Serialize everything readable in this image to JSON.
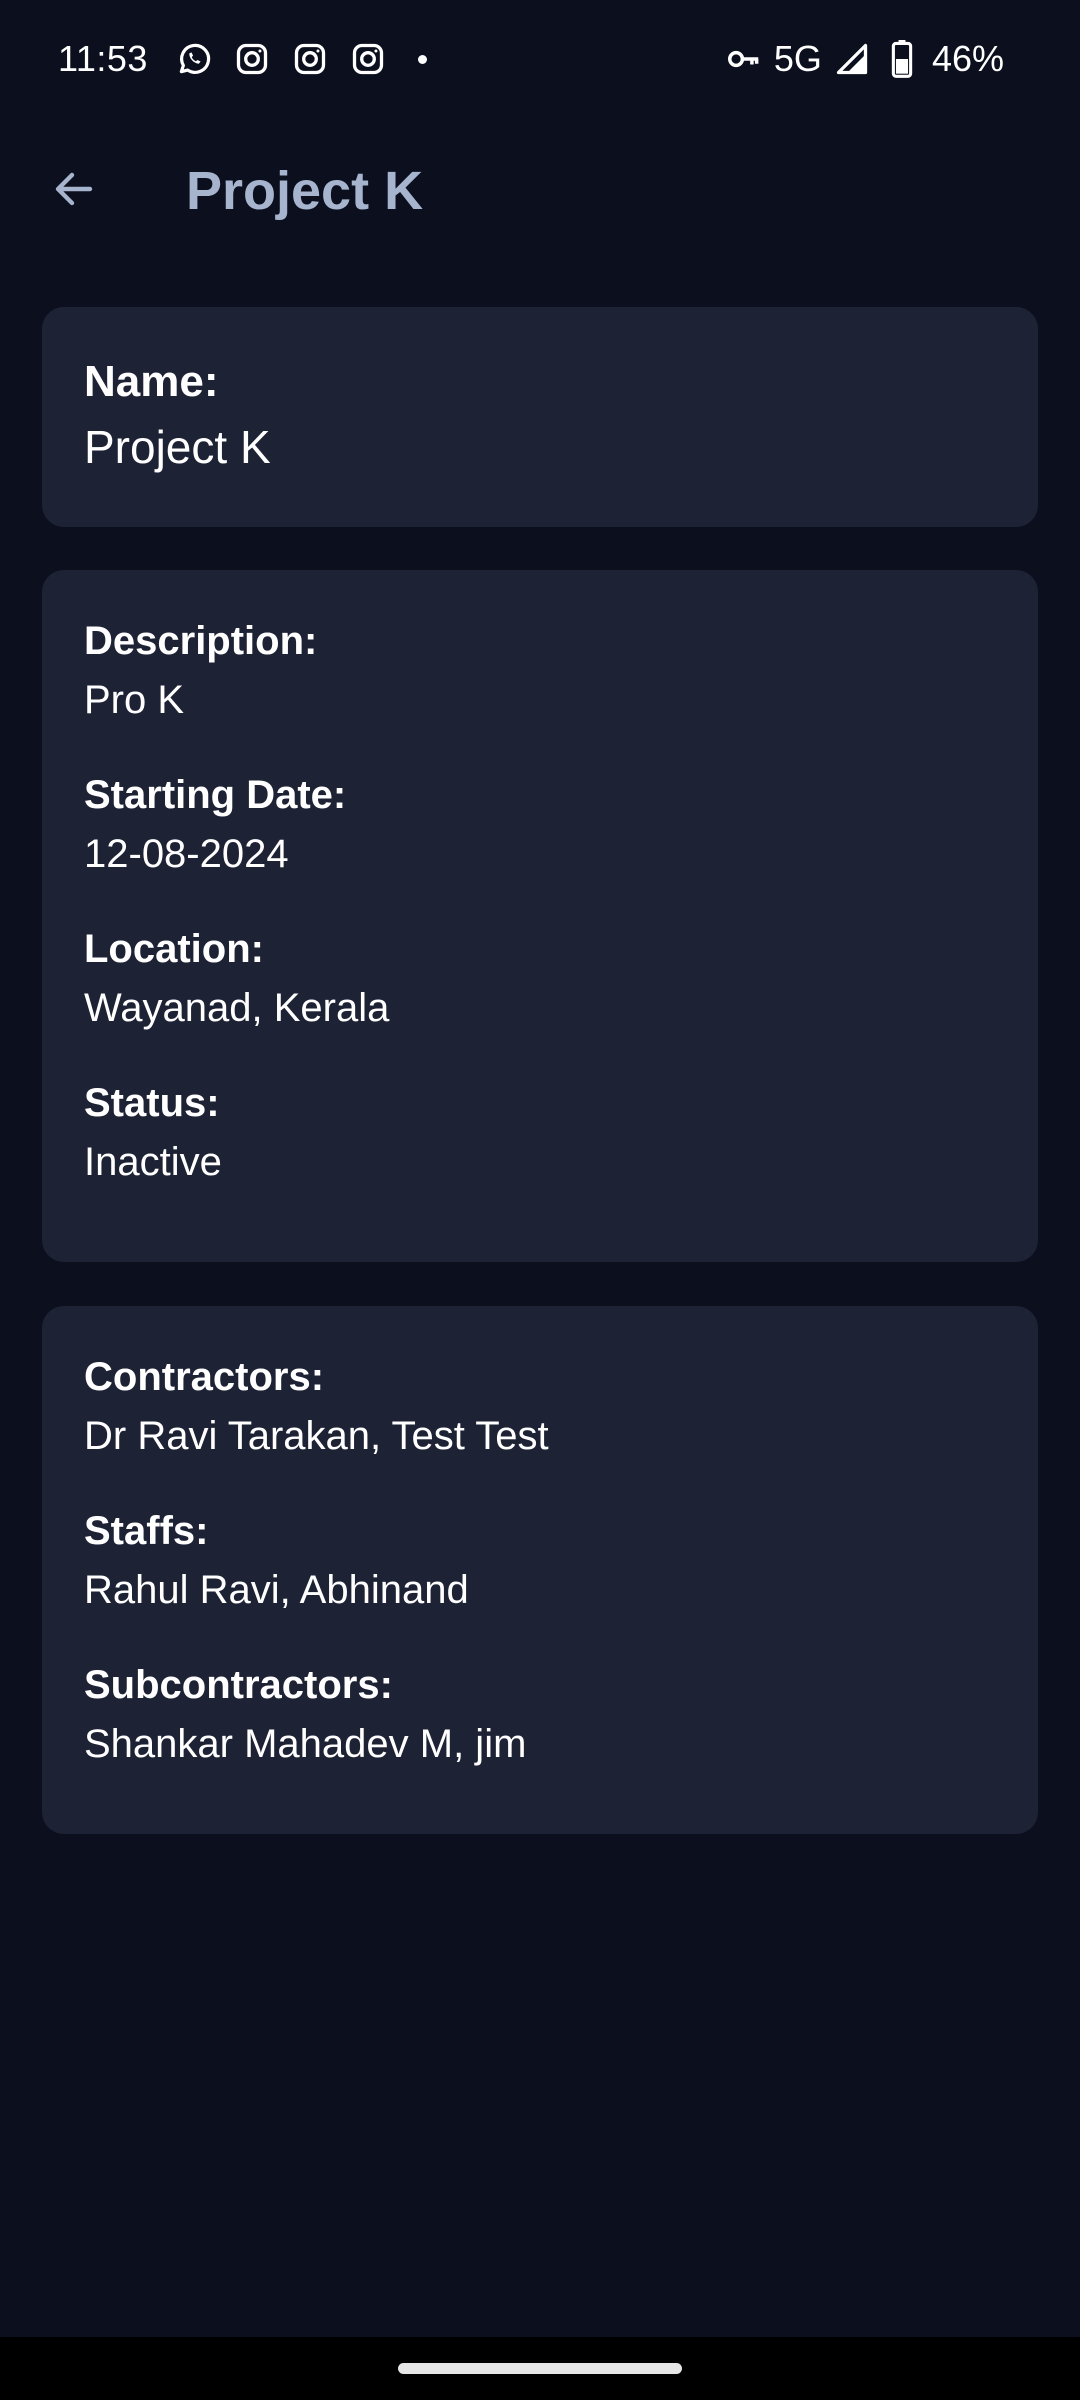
{
  "status_bar": {
    "time": "11:53",
    "left_icons": [
      "whatsapp-icon",
      "instagram-icon",
      "instagram-icon",
      "instagram-icon"
    ],
    "network": "5G",
    "battery": "46%",
    "right_icons": [
      "vpn-key-icon",
      "signal-icon",
      "battery-icon"
    ]
  },
  "app_bar": {
    "title": "Project K",
    "back_icon": "arrow-back-icon"
  },
  "name_card": {
    "label": "Name:",
    "value": "Project K"
  },
  "details_card": {
    "fields": [
      {
        "label": "Description:",
        "value": "Pro K"
      },
      {
        "label": "Starting Date:",
        "value": "12-08-2024"
      },
      {
        "label": "Location:",
        "value": "Wayanad, Kerala"
      },
      {
        "label": "Status:",
        "value": "Inactive"
      }
    ]
  },
  "people_card": {
    "fields": [
      {
        "label": "Contractors:",
        "value": "Dr Ravi Tarakan, Test Test"
      },
      {
        "label": "Staffs:",
        "value": "Rahul Ravi, Abhinand"
      },
      {
        "label": "Subcontractors:",
        "value": "Shankar Mahadev M, jim"
      }
    ]
  },
  "colors": {
    "background": "#0b0f1e",
    "card": "#1e2235",
    "title": "#a6b4cd",
    "text": "#ffffff"
  }
}
